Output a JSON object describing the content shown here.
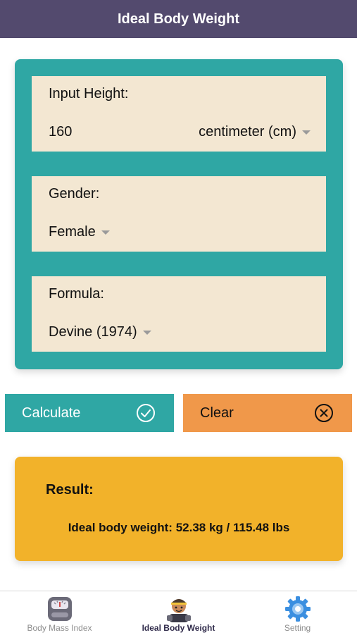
{
  "header": {
    "title": "Ideal Body Weight"
  },
  "form": {
    "height": {
      "label": "Input Height:",
      "value": "160",
      "unit": "centimeter (cm)"
    },
    "gender": {
      "label": "Gender:",
      "value": "Female"
    },
    "formula": {
      "label": "Formula:",
      "value": "Devine (1974)"
    }
  },
  "buttons": {
    "calculate": "Calculate",
    "clear": "Clear"
  },
  "result": {
    "title": "Result:",
    "text": "Ideal body weight: 52.38 kg / 115.48 lbs"
  },
  "tabs": [
    {
      "label": "Body Mass Index",
      "icon": "scale-icon",
      "active": false
    },
    {
      "label": "Ideal Body Weight",
      "icon": "athlete-icon",
      "active": true
    },
    {
      "label": "Setting",
      "icon": "gear-icon",
      "active": false
    }
  ],
  "colors": {
    "header": "#534a6e",
    "teal": "#2fa7a4",
    "field_bg": "#f3e7d2",
    "orange": "#f0984a",
    "result_bg": "#f2b22a"
  }
}
